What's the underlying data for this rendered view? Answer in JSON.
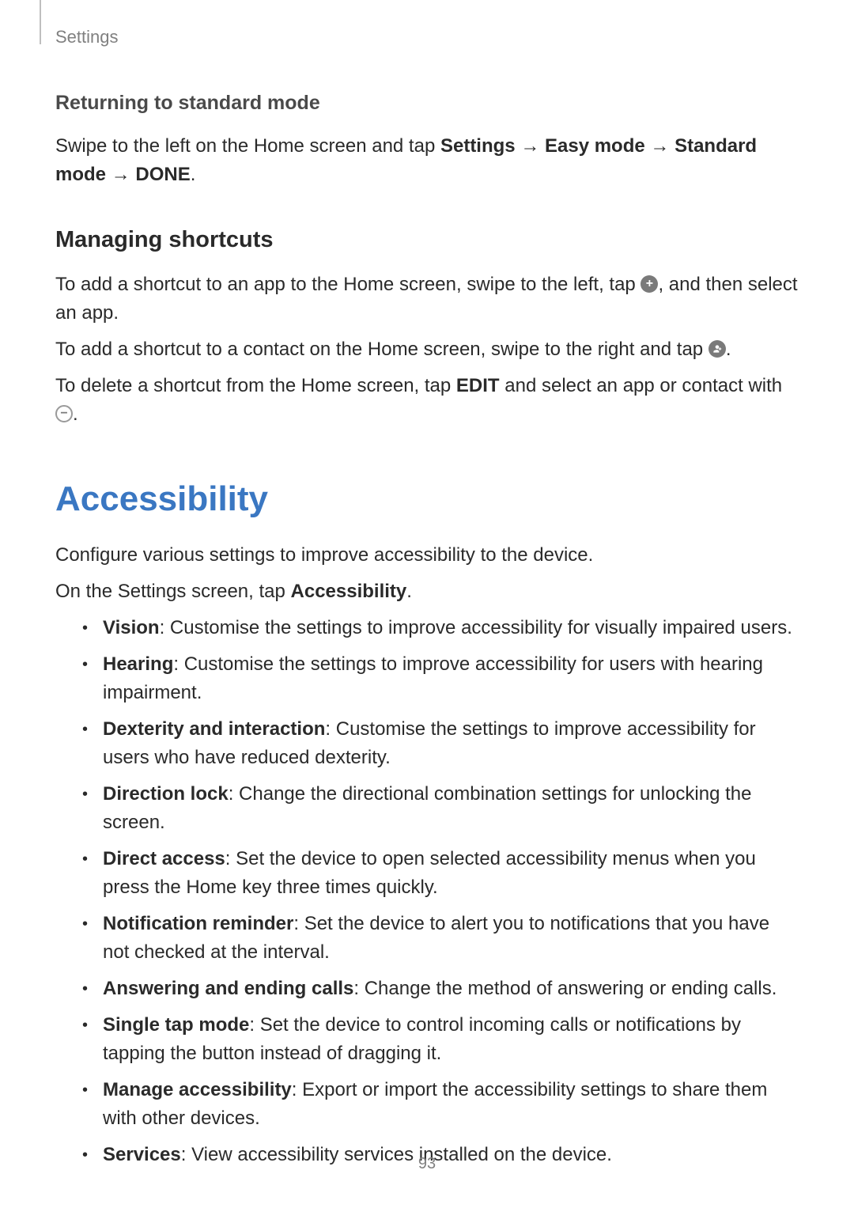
{
  "header": {
    "section": "Settings"
  },
  "returning": {
    "heading": "Returning to standard mode",
    "p1_a": "Swipe to the left on the Home screen and tap ",
    "p1_b1": "Settings",
    "p1_arrow": " → ",
    "p1_b2": "Easy mode",
    "p1_b3": "Standard mode",
    "p1_b4": "DONE",
    "p1_end": "."
  },
  "managing": {
    "heading": "Managing shortcuts",
    "p1_a": "To add a shortcut to an app to the Home screen, swipe to the left, tap ",
    "p1_b": ", and then select an app.",
    "p2_a": "To add a shortcut to a contact on the Home screen, swipe to the right and tap ",
    "p2_b": ".",
    "p3_a": "To delete a shortcut from the Home screen, tap ",
    "p3_edit": "EDIT",
    "p3_b": " and select an app or contact with ",
    "p3_c": "."
  },
  "accessibility": {
    "heading": "Accessibility",
    "intro1": "Configure various settings to improve accessibility to the device.",
    "intro2_a": "On the Settings screen, tap ",
    "intro2_b": "Accessibility",
    "intro2_c": ".",
    "items": [
      {
        "label": "Vision",
        "desc": ": Customise the settings to improve accessibility for visually impaired users."
      },
      {
        "label": "Hearing",
        "desc": ": Customise the settings to improve accessibility for users with hearing impairment."
      },
      {
        "label": "Dexterity and interaction",
        "desc": ": Customise the settings to improve accessibility for users who have reduced dexterity."
      },
      {
        "label": "Direction lock",
        "desc": ": Change the directional combination settings for unlocking the screen."
      },
      {
        "label": "Direct access",
        "desc": ": Set the device to open selected accessibility menus when you press the Home key three times quickly."
      },
      {
        "label": "Notification reminder",
        "desc": ": Set the device to alert you to notifications that you have not checked at the interval."
      },
      {
        "label": "Answering and ending calls",
        "desc": ": Change the method of answering or ending calls."
      },
      {
        "label": "Single tap mode",
        "desc": ": Set the device to control incoming calls or notifications by tapping the button instead of dragging it."
      },
      {
        "label": "Manage accessibility",
        "desc": ": Export or import the accessibility settings to share them with other devices."
      },
      {
        "label": "Services",
        "desc": ": View accessibility services installed on the device."
      }
    ]
  },
  "page_number": "93"
}
